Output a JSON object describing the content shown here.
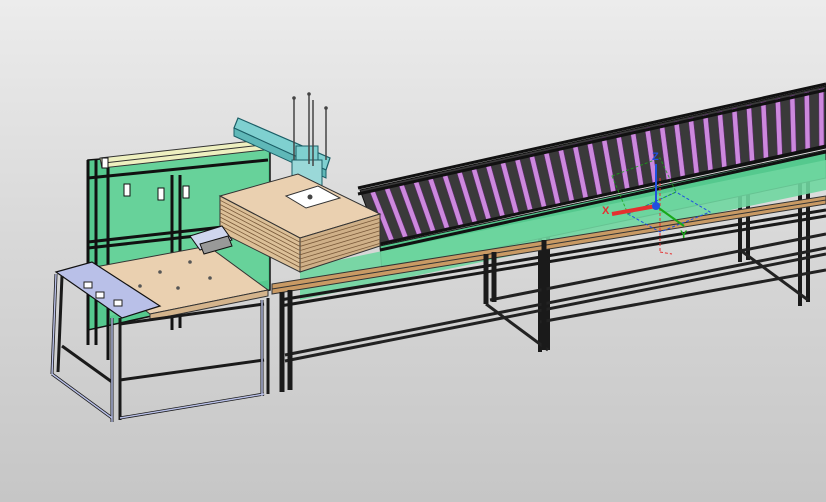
{
  "viewport": {
    "background_top": "#ececec",
    "background_bottom": "#c6c6c6"
  },
  "model": {
    "frame_color": "#1a1a1a",
    "panel_color": "#55c98e",
    "roller_color": "#cc88dd",
    "board_color": "#ead0b0",
    "cart_color": "#b9c0e8",
    "gantry_color": "#7fd0d0",
    "rail_color": "#c99a64"
  },
  "triad": {
    "x_label": "X",
    "y_label": "Y",
    "z_label": "Z",
    "x_color": "#e53030",
    "y_color": "#18a818",
    "z_color": "#2050e0"
  }
}
